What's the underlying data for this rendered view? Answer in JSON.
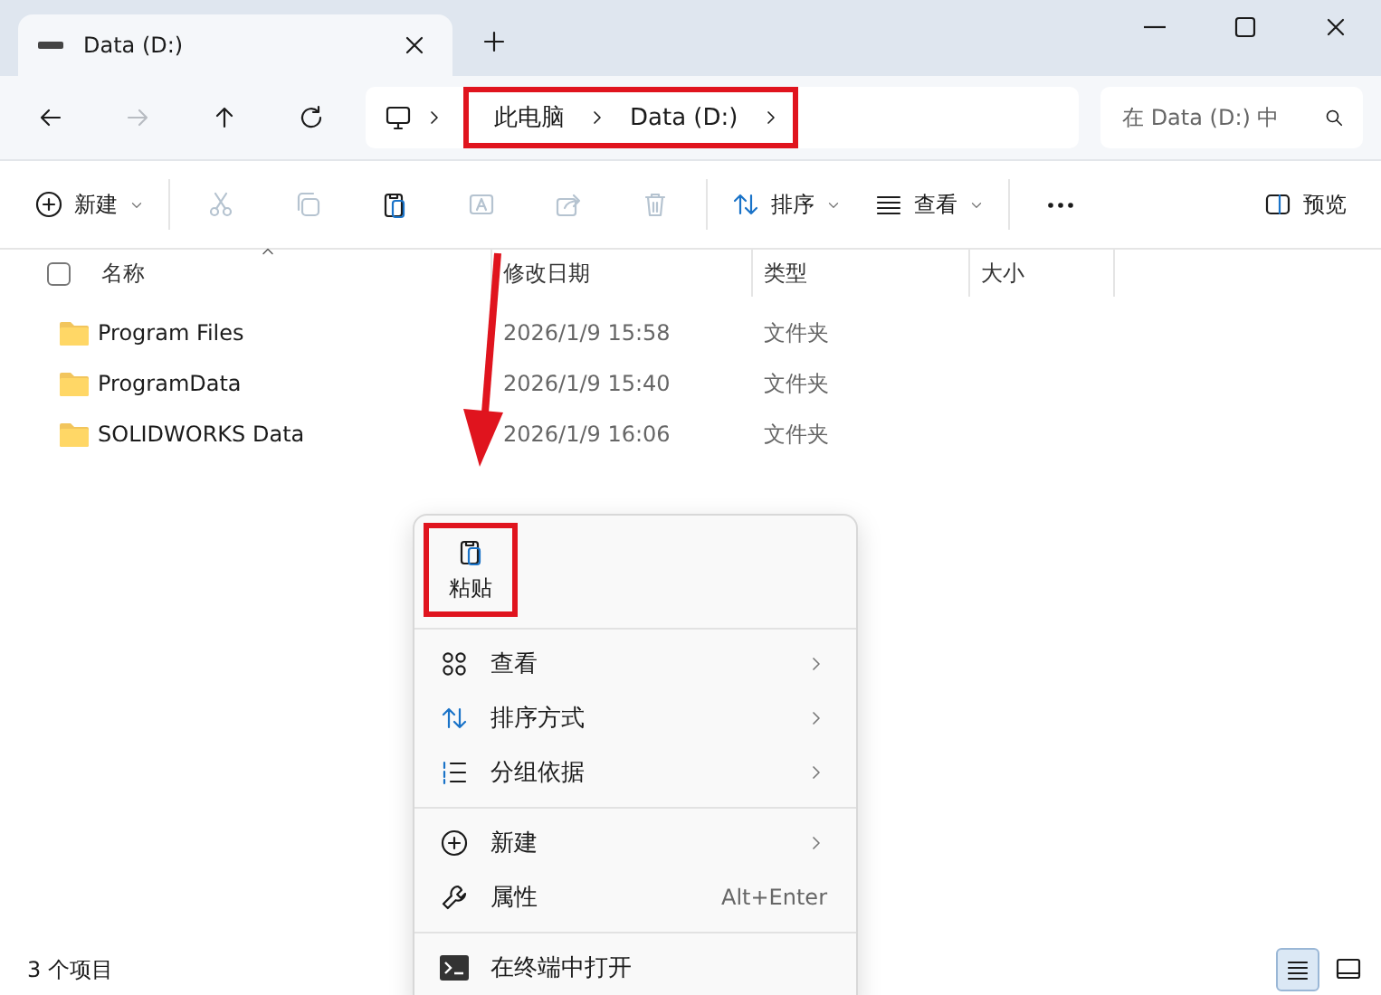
{
  "tab": {
    "title": "Data (D:)",
    "selected": true
  },
  "address": {
    "crumbs": [
      "此电脑",
      "Data (D:)"
    ]
  },
  "search": {
    "placeholder": "在 Data (D:) 中"
  },
  "toolbar": [
    {
      "kind": "new",
      "label": "新建",
      "disabled": false
    },
    {
      "kind": "cut",
      "disabled": true
    },
    {
      "kind": "copy",
      "disabled": true
    },
    {
      "kind": "paste",
      "disabled": false
    },
    {
      "kind": "rename",
      "disabled": true
    },
    {
      "kind": "share",
      "disabled": true
    },
    {
      "kind": "delete",
      "disabled": true
    },
    {
      "kind": "sort",
      "label": "排序",
      "disabled": false
    },
    {
      "kind": "view",
      "label": "查看",
      "disabled": false
    },
    {
      "kind": "more",
      "disabled": false
    },
    {
      "kind": "preview",
      "label": "预览",
      "disabled": false
    }
  ],
  "select_all": {
    "checked": false
  },
  "columns": [
    "名称",
    "修改日期",
    "类型",
    "大小"
  ],
  "rows": [
    {
      "name": "Program Files",
      "date": "2026/1/9 15:58",
      "type": "文件夹"
    },
    {
      "name": "ProgramData",
      "date": "2026/1/9 15:40",
      "type": "文件夹"
    },
    {
      "name": "SOLIDWORKS Data",
      "date": "2026/1/9 16:06",
      "type": "文件夹"
    }
  ],
  "context_menu": {
    "paste_label": "粘贴",
    "groups": [
      [
        {
          "kind": "view",
          "label": "查看",
          "submenu": true
        },
        {
          "kind": "sort",
          "label": "排序方式",
          "submenu": true
        },
        {
          "kind": "group",
          "label": "分组依据",
          "submenu": true
        }
      ],
      [
        {
          "kind": "new",
          "label": "新建",
          "submenu": true
        },
        {
          "kind": "properties",
          "label": "属性",
          "shortcut": "Alt+Enter",
          "submenu": false
        }
      ],
      [
        {
          "kind": "terminal",
          "label": "在终端中打开",
          "submenu": false
        }
      ]
    ]
  },
  "status_bar": {
    "count": "3 个项目",
    "views": [
      {
        "kind": "details",
        "selected": true
      },
      {
        "kind": "tiles",
        "selected": false
      }
    ]
  }
}
